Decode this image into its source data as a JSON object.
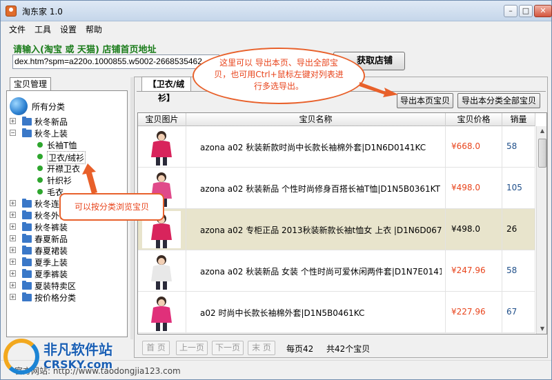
{
  "window": {
    "title": "淘东家 1.0"
  },
  "menu": [
    "文件",
    "工具",
    "设置",
    "帮助"
  ],
  "store_url": {
    "prompt": "请输入(淘宝 或 天猫) 店铺首页地址",
    "value": "dex.htm?spm=a220o.1000855.w5002-2668535462",
    "fetch_button": "获取店铺"
  },
  "left_panel": {
    "tab": "宝贝管理",
    "root": "所有分类",
    "nodes": [
      {
        "label": "秋冬新品",
        "level": 1,
        "expanded": false
      },
      {
        "label": "秋冬上装",
        "level": 1,
        "expanded": true
      },
      {
        "label": "长袖T恤",
        "level": 2
      },
      {
        "label": "卫衣/绒衫",
        "level": 2,
        "selected": true
      },
      {
        "label": "开襟卫衣",
        "level": 2
      },
      {
        "label": "针织衫",
        "level": 2
      },
      {
        "label": "毛衣",
        "level": 2
      },
      {
        "label": "秋冬连",
        "level": 1,
        "expanded": false
      },
      {
        "label": "秋冬外套",
        "level": 1,
        "expanded": false
      },
      {
        "label": "秋冬裤装",
        "level": 1,
        "expanded": false
      },
      {
        "label": "春夏新品",
        "level": 1,
        "expanded": false
      },
      {
        "label": "春夏裙装",
        "level": 1,
        "expanded": false
      },
      {
        "label": "夏季上装",
        "level": 1,
        "expanded": false
      },
      {
        "label": "夏季裤装",
        "level": 1,
        "expanded": false
      },
      {
        "label": "夏装特卖区",
        "level": 1,
        "expanded": false
      },
      {
        "label": "按价格分类",
        "level": 1,
        "expanded": false
      }
    ]
  },
  "right_panel": {
    "category_tab": "【卫衣/绒衫】",
    "export_page_button": "导出本页宝贝",
    "export_category_button": "导出本分类全部宝贝",
    "columns": [
      "宝贝图片",
      "宝贝名称",
      "宝贝价格",
      "销量"
    ],
    "rows": [
      {
        "name": "azona a02 秋装新款时尚中长款长袖棉外套|D1N6D0141KC",
        "price": "¥668.0",
        "sales": "58",
        "highlight": false,
        "color": "#d8245c"
      },
      {
        "name": "azona a02 秋装新品 个性时尚修身百搭长袖T恤|D1N5B0361KT",
        "price": "¥498.0",
        "sales": "105",
        "highlight": false,
        "color": "#e04a8a"
      },
      {
        "name": "azona a02 专柜正品 2013秋装新款长袖t恤女 上衣 |D1N6D067...",
        "price": "¥498.0",
        "sales": "26",
        "highlight": true,
        "color": "#d8245c"
      },
      {
        "name": "azona a02 秋装新品 女装 个性时尚可爱休闲两件套|D1N7E0141...",
        "price": "¥247.96",
        "sales": "58",
        "highlight": false,
        "color": "#e8e8e8"
      },
      {
        "name": "a02 时尚中长款长袖棉外套|D1N5B0461KC",
        "price": "¥227.96",
        "sales": "67",
        "highlight": false,
        "color": "#e0307a"
      }
    ],
    "pager": {
      "first": "首 页",
      "prev": "上一页",
      "next": "下一页",
      "last": "末 页",
      "per_page": "每页42",
      "total": "共42个宝贝"
    }
  },
  "status": {
    "url": "官方网站: http://www.taodongjia123.com"
  },
  "annotations": {
    "export_tip": "这里可以 导出本页、导出全部宝贝，也可用Ctrl+鼠标左键对列表进行多选导出。",
    "browse_tip": "可以按分类浏览宝贝"
  },
  "watermark": {
    "name": "非凡软件站",
    "domain": "CRSKY.com"
  },
  "colors": {
    "accent": "#e8602a",
    "price": "#e8441c",
    "prompt": "#1a7c1a",
    "highlight_row": "#e8e4cc"
  }
}
